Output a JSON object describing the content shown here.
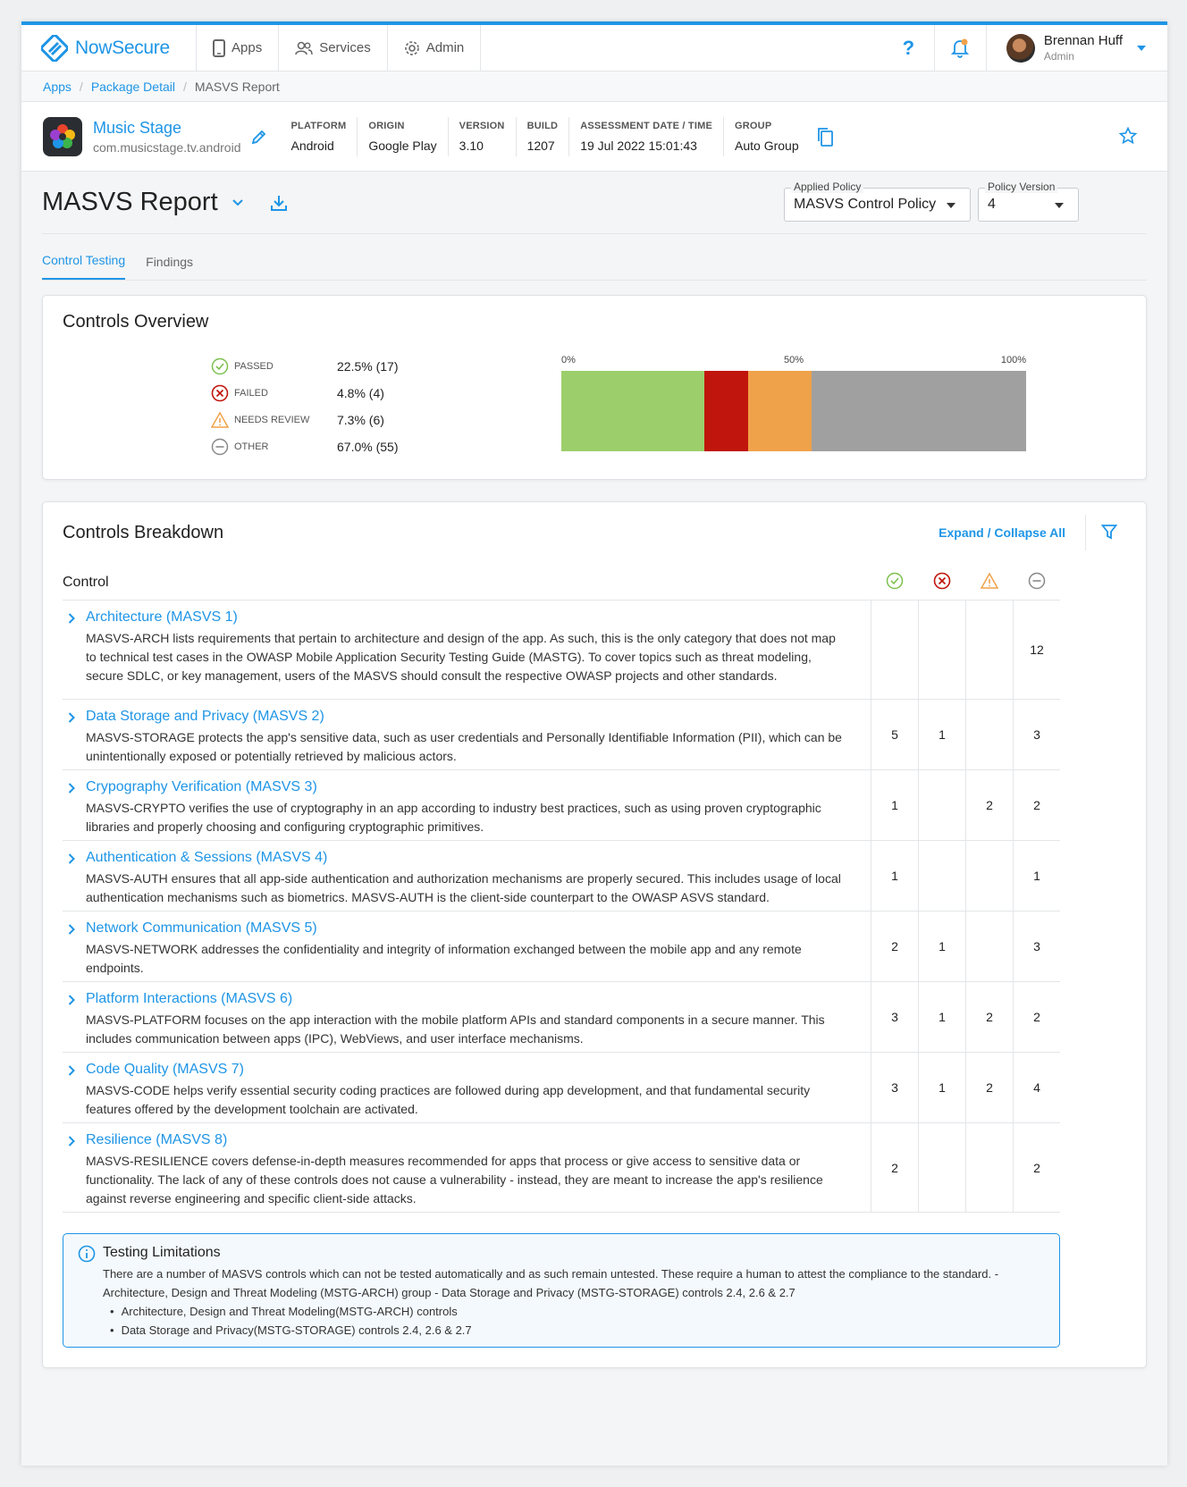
{
  "nav": {
    "logo": "NowSecure",
    "items": [
      {
        "label": "Apps"
      },
      {
        "label": "Services"
      },
      {
        "label": "Admin"
      }
    ],
    "help": "?",
    "user": {
      "name": "Brennan Huff",
      "role": "Admin"
    }
  },
  "breadcrumb": [
    "Apps",
    "Package Detail",
    "MASVS Report"
  ],
  "app": {
    "name": "Music Stage",
    "package": "com.musicstage.tv.android",
    "meta": [
      {
        "label": "PLATFORM",
        "value": "Android"
      },
      {
        "label": "ORIGIN",
        "value": "Google Play"
      },
      {
        "label": "VERSION",
        "value": "3.10"
      },
      {
        "label": "BUILD",
        "value": "1207"
      },
      {
        "label": "ASSESSMENT DATE / TIME",
        "value": "19 Jul 2022 15:01:43"
      },
      {
        "label": "GROUP",
        "value": "Auto Group"
      }
    ]
  },
  "report": {
    "title": "MASVS Report",
    "applied_policy": {
      "label": "Applied Policy",
      "value": "MASVS Control Policy"
    },
    "policy_version": {
      "label": "Policy Version",
      "value": "4"
    }
  },
  "tabs": [
    {
      "label": "Control Testing",
      "active": true
    },
    {
      "label": "Findings",
      "active": false
    }
  ],
  "overview": {
    "title": "Controls Overview",
    "legend": [
      {
        "label": "PASSED",
        "value": "22.5% (17)",
        "color": "#9ccf6b"
      },
      {
        "label": "FAILED",
        "value": "4.8% (4)",
        "color": "#c0150c"
      },
      {
        "label": "NEEDS REVIEW",
        "value": "7.3% (6)",
        "color": "#f0a24a"
      },
      {
        "label": "OTHER",
        "value": "67.0% (55)",
        "color": "#a0a0a0"
      }
    ],
    "ticks": [
      "0%",
      "50%",
      "100%"
    ],
    "segments": [
      {
        "name": "passed",
        "percent": 30.7,
        "color": "#9ccf6b"
      },
      {
        "name": "failed",
        "percent": 9.5,
        "color": "#c0150c"
      },
      {
        "name": "needs-review",
        "percent": 13.7,
        "color": "#f0a24a"
      },
      {
        "name": "other",
        "percent": 46.1,
        "color": "#a0a0a0"
      }
    ]
  },
  "breakdown": {
    "title": "Controls Breakdown",
    "expand_label": "Expand / Collapse All",
    "control_header": "Control",
    "rows": [
      {
        "title": "Architecture (MASVS 1)",
        "desc": "MASVS-ARCH lists requirements that pertain to architecture and design of the app. As such, this is the only category that does not map to technical test cases in the OWASP Mobile Application Security Testing Guide (MASTG). To cover topics such as threat modeling, secure SDLC, or key management, users of the MASVS should consult the respective OWASP projects and other standards.",
        "passed": "",
        "failed": "",
        "review": "",
        "other": "12"
      },
      {
        "title": "Data Storage and Privacy (MASVS 2)",
        "desc": "MASVS-STORAGE protects the app's sensitive data, such as user credentials and Personally Identifiable Information (PII), which can be unintentionally exposed or potentially retrieved by malicious actors.",
        "passed": "5",
        "failed": "1",
        "review": "",
        "other": "3"
      },
      {
        "title": "Crypography Verification (MASVS 3)",
        "desc": "MASVS-CRYPTO verifies the use of cryptography in an app according to industry best practices, such as using proven cryptographic libraries and properly choosing and configuring cryptographic primitives.",
        "passed": "1",
        "failed": "",
        "review": "2",
        "other": "2"
      },
      {
        "title": "Authentication & Sessions (MASVS 4)",
        "desc": "MASVS-AUTH ensures that all app-side authentication and authorization mechanisms are properly secured. This includes usage of local authentication mechanisms such as biometrics. MASVS-AUTH is the client-side counterpart to the OWASP ASVS standard.",
        "passed": "1",
        "failed": "",
        "review": "",
        "other": "1"
      },
      {
        "title": "Network Communication (MASVS 5)",
        "desc": "MASVS-NETWORK addresses the confidentiality and integrity of information exchanged between the mobile app and any remote endpoints.",
        "passed": "2",
        "failed": "1",
        "review": "",
        "other": "3"
      },
      {
        "title": "Platform Interactions (MASVS 6)",
        "desc": "MASVS-PLATFORM focuses on the app interaction with the mobile platform APIs and standard components in a secure manner. This includes communication between apps (IPC), WebViews, and user interface mechanisms.",
        "passed": "3",
        "failed": "1",
        "review": "2",
        "other": "2"
      },
      {
        "title": "Code Quality (MASVS 7)",
        "desc": "MASVS-CODE helps verify essential security coding practices are followed during app development, and that fundamental security features offered by the development toolchain are activated.",
        "passed": "3",
        "failed": "1",
        "review": "2",
        "other": "4"
      },
      {
        "title": "Resilience (MASVS 8)",
        "desc": "MASVS-RESILIENCE covers defense-in-depth measures recommended for apps that process or give access to sensitive data or functionality. The lack of any of these controls does not cause a vulnerability - instead, they are meant to increase the app's resilience against reverse engineering and specific client-side attacks.",
        "passed": "2",
        "failed": "",
        "review": "",
        "other": "2"
      }
    ],
    "limitations": {
      "title": "Testing Limitations",
      "text": "There are a number of MASVS controls which can not be tested automatically and as such remain untested. These require a human to attest the compliance to the standard. - Architecture, Design and Threat Modeling (MSTG-ARCH) group - Data Storage and Privacy (MSTG-STORAGE) controls 2.4, 2.6 & 2.7",
      "items": [
        "Architecture, Design and Threat Modeling(MSTG-ARCH) controls",
        "Data Storage and Privacy(MSTG-STORAGE) controls 2.4, 2.6 & 2.7"
      ]
    }
  }
}
